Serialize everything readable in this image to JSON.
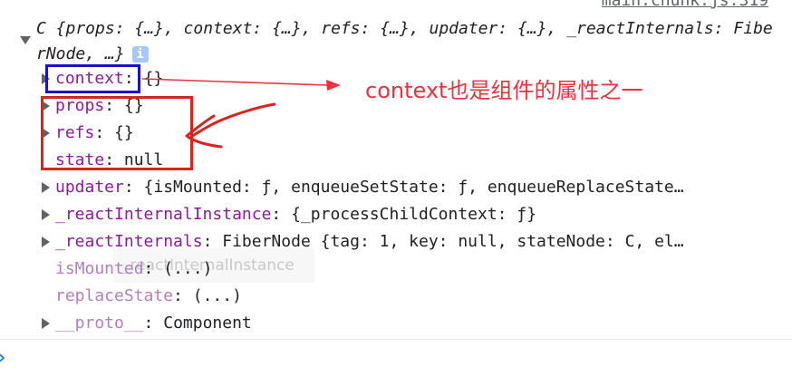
{
  "source_link": "main.chunk.js:319",
  "summary": {
    "text": "C {props: {…}, context: {…}, refs: {…}, updater: {…}, _reactInternals: FiberNode, …}",
    "info_icon": "info-icon"
  },
  "properties": [
    {
      "key": "context",
      "sep": ": ",
      "value": "{}",
      "expandable": true
    },
    {
      "key": "props",
      "sep": ": ",
      "value": "{}",
      "expandable": true
    },
    {
      "key": "refs",
      "sep": ": ",
      "value": "{}",
      "expandable": true
    },
    {
      "key": "state",
      "sep": ": ",
      "value": "null",
      "expandable": false
    },
    {
      "key": "updater",
      "sep": ": ",
      "value": "{isMounted: ƒ, enqueueSetState: ƒ, enqueueReplaceState…",
      "expandable": true
    },
    {
      "key": "_reactInternalInstance",
      "sep": ": ",
      "value": "{_processChildContext: ƒ}",
      "expandable": true
    },
    {
      "key": "_reactInternals",
      "sep": ": ",
      "value": "FiberNode {tag: 1, key: null, stateNode: C, el…",
      "expandable": true
    },
    {
      "key": "isMounted",
      "sep": ": ",
      "value": "(...)",
      "expandable": false
    },
    {
      "key": "replaceState",
      "sep": ": ",
      "value": "(...)",
      "expandable": false
    },
    {
      "key": "__proto__",
      "sep": ": ",
      "value": "Component",
      "expandable": true
    }
  ],
  "annotation": {
    "text": "context也是组件的属性之一",
    "color": "#e8333f"
  },
  "ghost_tooltip": "_reactInternalInstance",
  "colors": {
    "key": "#8a1a9b",
    "blue_box": "#1a12c8",
    "red_box": "#d9231e",
    "link": "#5f6368"
  }
}
